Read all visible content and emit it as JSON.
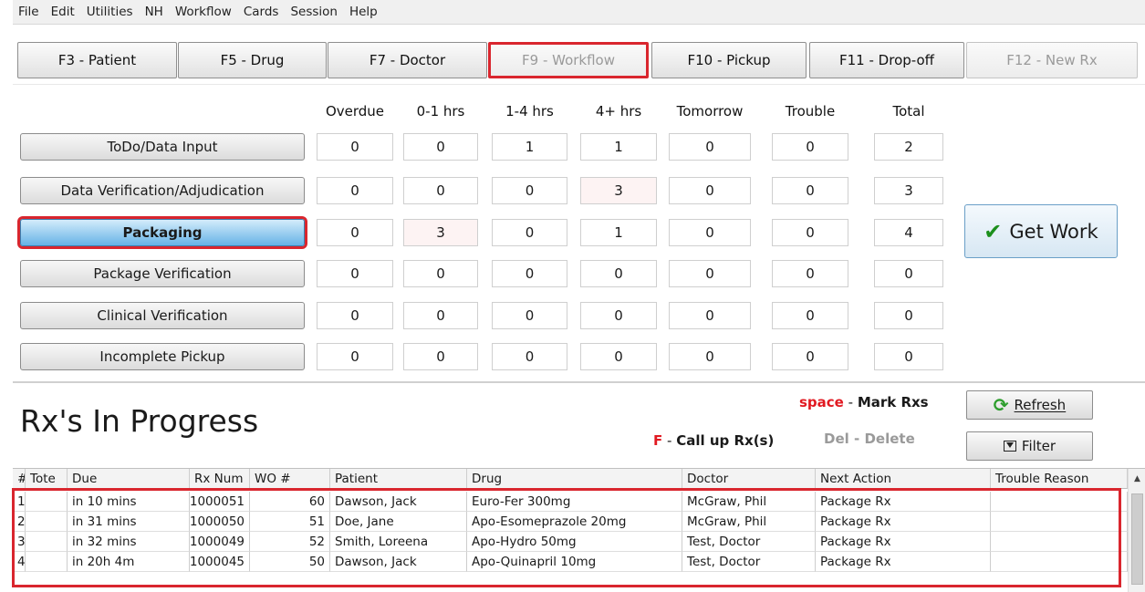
{
  "menu": [
    "File",
    "Edit",
    "Utilities",
    "NH",
    "Workflow",
    "Cards",
    "Session",
    "Help"
  ],
  "fkeys": [
    {
      "label": "F3 - Patient",
      "disabled": false,
      "highlight": false
    },
    {
      "label": "F5 - Drug",
      "disabled": false,
      "highlight": false
    },
    {
      "label": "F7 - Doctor",
      "disabled": false,
      "highlight": false
    },
    {
      "label": "F9 - Workflow",
      "disabled": true,
      "highlight": true
    },
    {
      "label": "F10 - Pickup",
      "disabled": false,
      "highlight": false
    },
    {
      "label": "F11 - Drop-off",
      "disabled": false,
      "highlight": false
    },
    {
      "label": "F12 - New Rx",
      "disabled": true,
      "highlight": false
    }
  ],
  "workflow": {
    "columns": [
      "Overdue",
      "0-1 hrs",
      "1-4 hrs",
      "4+ hrs",
      "Tomorrow",
      "Trouble",
      "Total"
    ],
    "rows": [
      {
        "label": "ToDo/Data Input",
        "active": false,
        "values": [
          "0",
          "0",
          "1",
          "1",
          "0",
          "0",
          "2"
        ]
      },
      {
        "label": "Data Verification/Adjudication",
        "active": false,
        "values": [
          "0",
          "0",
          "0",
          "3",
          "0",
          "0",
          "3"
        ]
      },
      {
        "label": "Packaging",
        "active": true,
        "values": [
          "0",
          "3",
          "0",
          "1",
          "0",
          "0",
          "4"
        ]
      },
      {
        "label": "Package Verification",
        "active": false,
        "values": [
          "0",
          "0",
          "0",
          "0",
          "0",
          "0",
          "0"
        ]
      },
      {
        "label": "Clinical Verification",
        "active": false,
        "values": [
          "0",
          "0",
          "0",
          "0",
          "0",
          "0",
          "0"
        ]
      },
      {
        "label": "Incomplete Pickup",
        "active": false,
        "values": [
          "0",
          "0",
          "0",
          "0",
          "0",
          "0",
          "0"
        ]
      }
    ],
    "get_work_label": "Get Work"
  },
  "progress": {
    "title": "Rx's In Progress",
    "hint_space_key": "space",
    "hint_space_sep": " - ",
    "hint_space_action": "Mark Rxs",
    "hint_f_key": "F",
    "hint_f_sep": " - ",
    "hint_f_action": "Call up Rx(s)",
    "hint_del_key": "Del",
    "hint_del_sep": " - ",
    "hint_del_action": "Delete",
    "refresh_label": "Refresh",
    "filter_label": "Filter"
  },
  "grid": {
    "columns": [
      "#",
      "Tote",
      "Due",
      "Rx Num",
      "WO #",
      "Patient",
      "Drug",
      "Doctor",
      "Next Action",
      "Trouble Reason"
    ],
    "rows": [
      [
        "1",
        "",
        "in 10 mins",
        "1000051",
        "60",
        "Dawson, Jack",
        "Euro-Fer 300mg",
        "McGraw, Phil",
        "Package Rx",
        ""
      ],
      [
        "2",
        "",
        "in 31 mins",
        "1000050",
        "51",
        "Doe, Jane",
        "Apo-Esomeprazole 20mg",
        "McGraw, Phil",
        "Package Rx",
        ""
      ],
      [
        "3",
        "",
        "in 32 mins",
        "1000049",
        "52",
        "Smith, Loreena",
        "Apo-Hydro 50mg",
        "Test, Doctor",
        "Package Rx",
        ""
      ],
      [
        "4",
        "",
        "in 20h 4m",
        "1000045",
        "50",
        "Dawson, Jack",
        "Apo-Quinapril 10mg",
        "Test, Doctor",
        "Package Rx",
        ""
      ]
    ]
  },
  "colors": {
    "highlight_red": "#d9262e",
    "active_blue": "#66b3e6",
    "get_work_check": "#1c8f1c"
  }
}
